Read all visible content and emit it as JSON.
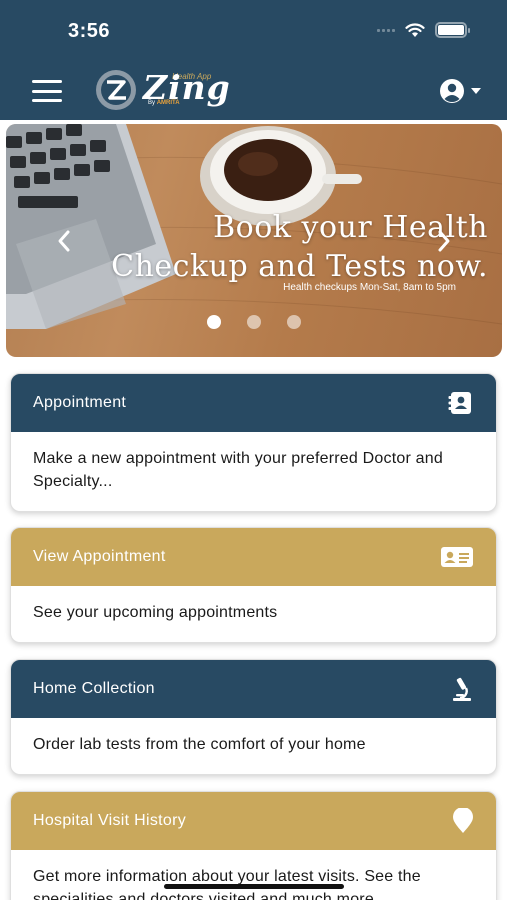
{
  "status_bar": {
    "time": "3:56"
  },
  "header": {
    "logo_tagline": "Health App",
    "logo_name": "Zing",
    "logo_by": "By",
    "logo_brand": "AMRITA"
  },
  "banner": {
    "title_line1": "Book your Health",
    "title_line2": "Checkup and Tests now.",
    "subtitle": "Health checkups Mon-Sat, 8am to 5pm",
    "slides": 3,
    "active_slide": 1
  },
  "cards": [
    {
      "title": "Appointment",
      "description": "Make a new appointment with your preferred Doctor and Specialty...",
      "icon": "contact-card-icon",
      "color": "#284a63"
    },
    {
      "title": "View Appointment",
      "description": "See your upcoming appointments",
      "icon": "id-card-icon",
      "color": "#c9a85c"
    },
    {
      "title": "Home Collection",
      "description": "Order lab tests from the comfort of your home",
      "icon": "microscope-icon",
      "color": "#284a63"
    },
    {
      "title": "Hospital Visit History",
      "description": "Get more information about your latest visits. See the specialities and doctors visited and much more.",
      "icon": "location-pin-icon",
      "color": "#c9a85c"
    }
  ],
  "colors": {
    "primary": "#284a63",
    "accent": "#c9a85c"
  }
}
